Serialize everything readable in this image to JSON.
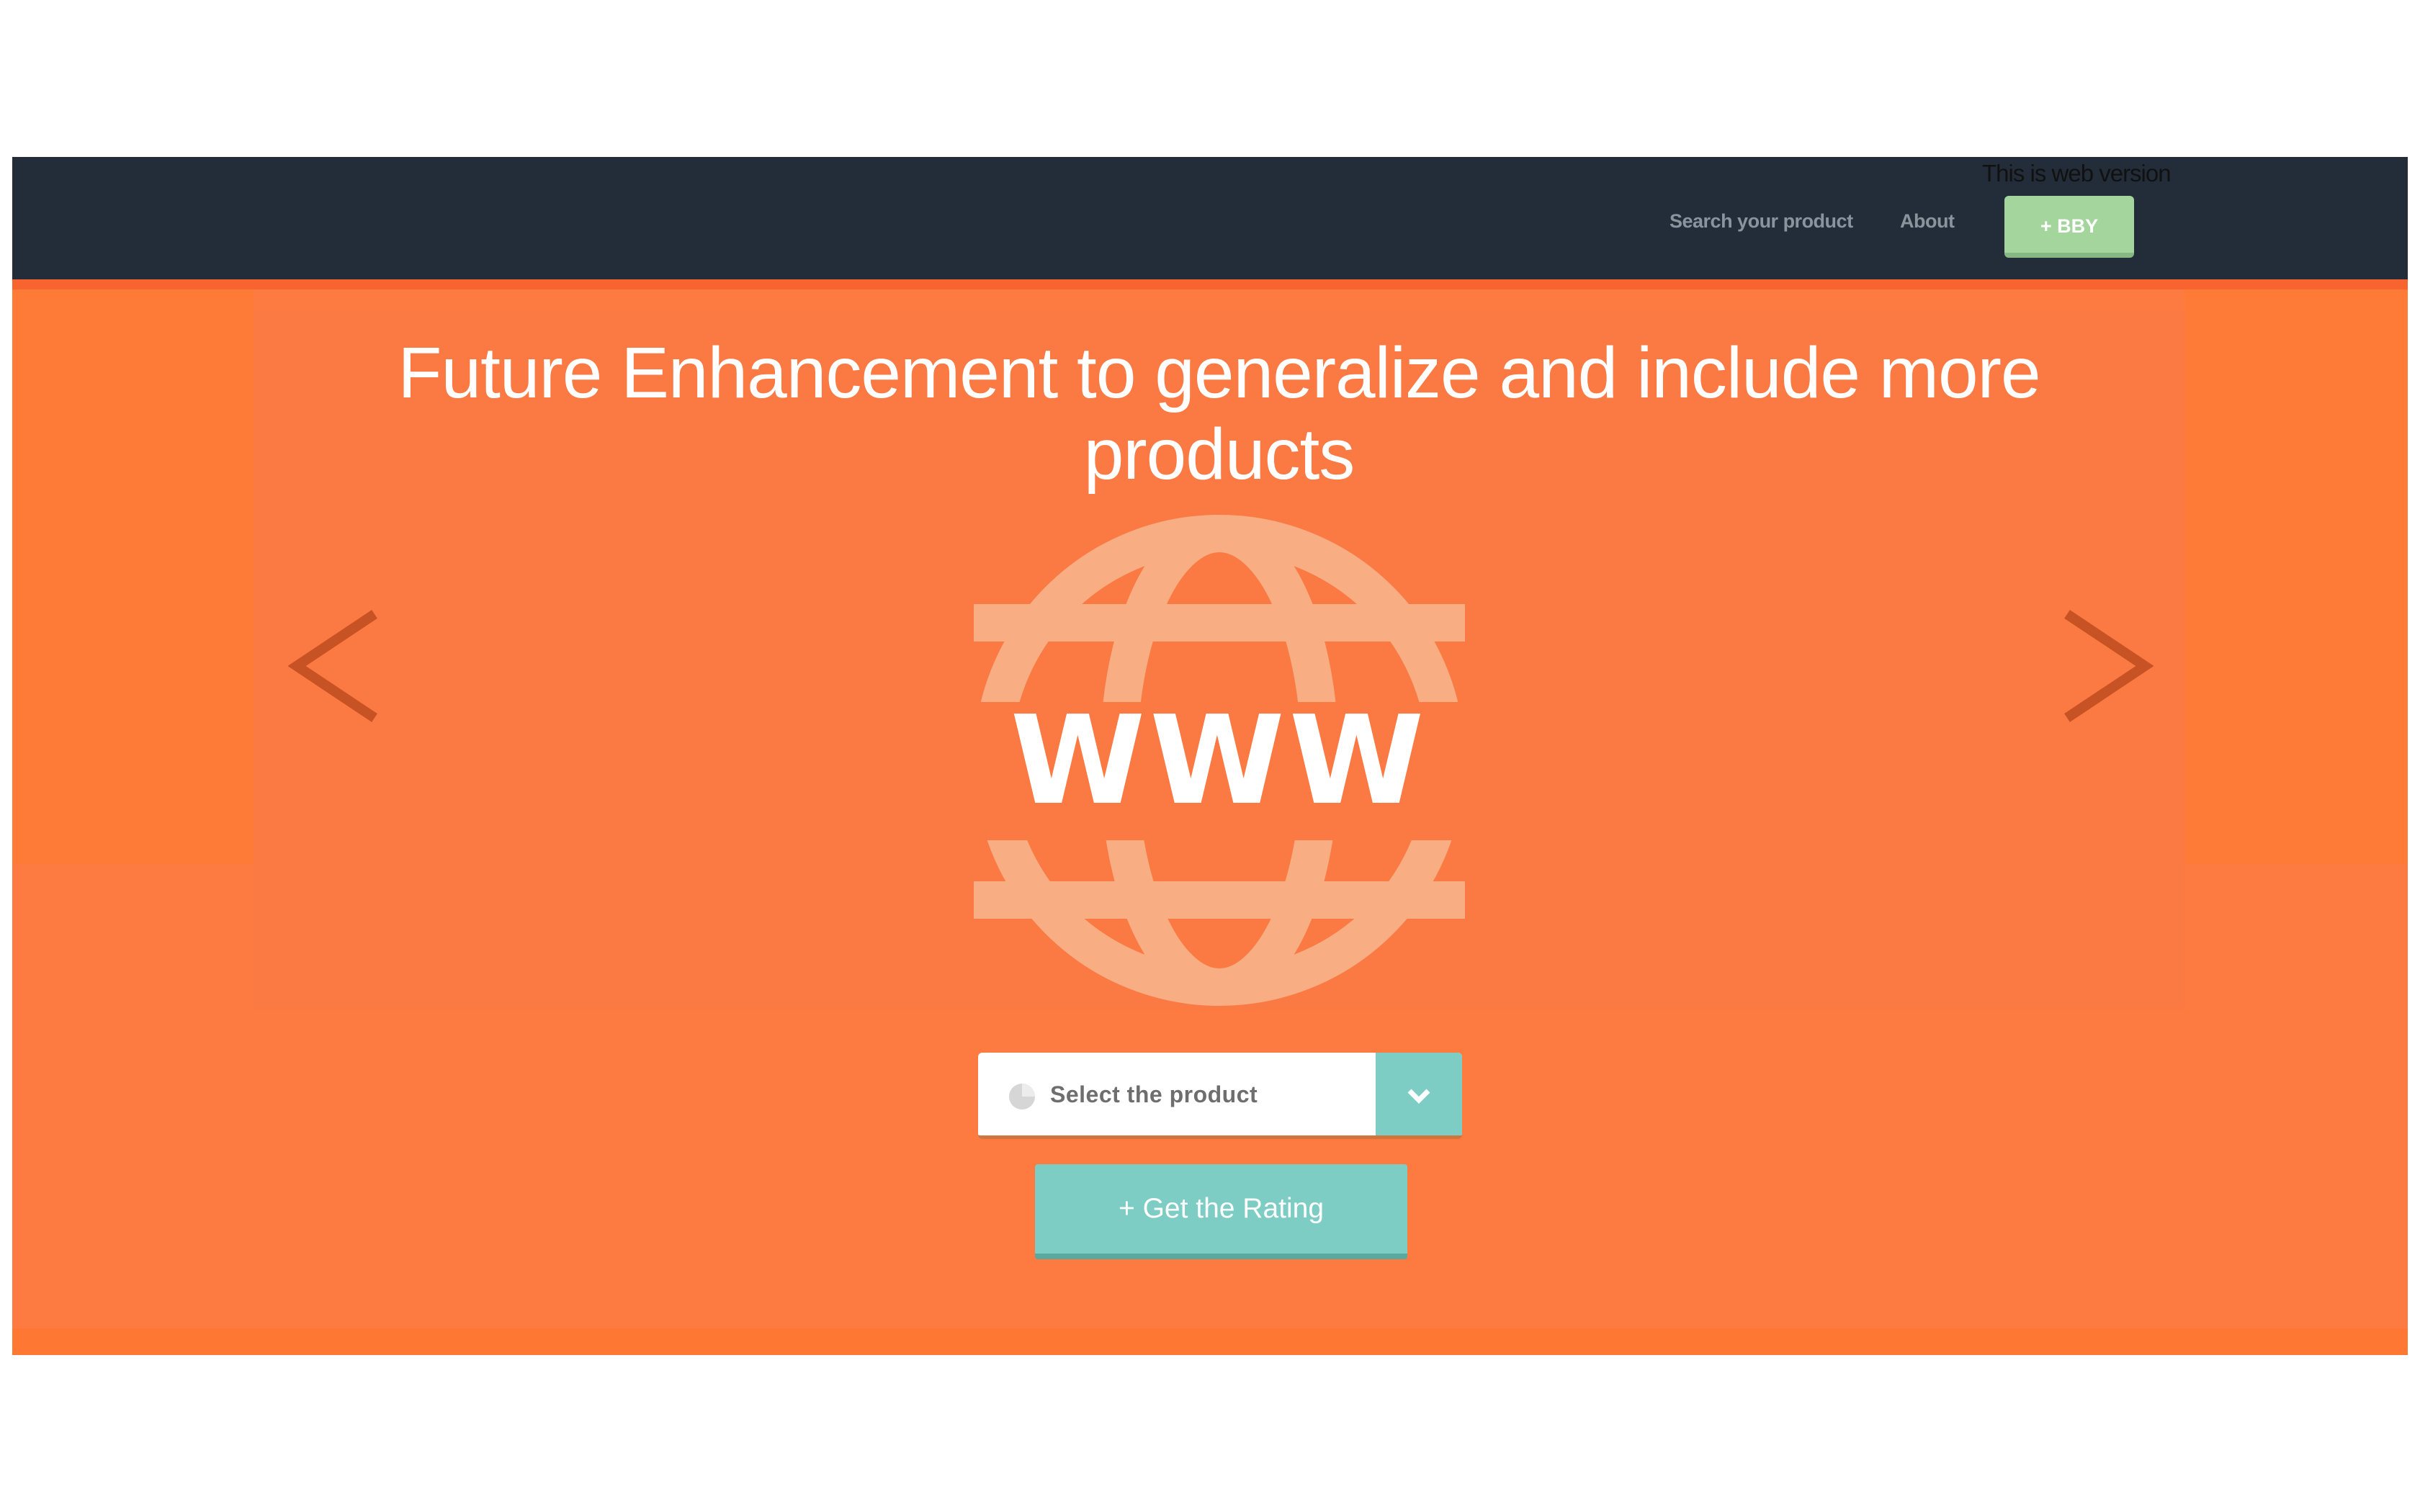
{
  "notice": {
    "text": "This is web version"
  },
  "nav": {
    "search_link": "Search your product",
    "about_link": "About",
    "cta_label": "+ BBY",
    "background": "#232d39",
    "cta_color": "#a3d59d"
  },
  "hero": {
    "headline": "Future Enhancement to generalize and include more products",
    "background": "#fd7b41",
    "prev_icon": "chevron-left-icon",
    "next_icon": "chevron-right-icon",
    "illustration_icon": "www-globe-icon",
    "illustration_text": "WWW"
  },
  "product_select": {
    "placeholder": "Select the product",
    "icon": "pie-chart-icon",
    "toggle_icon": "chevron-down-icon",
    "accent": "#7ecdc4"
  },
  "rating_button": {
    "label": "+ Get the Rating"
  }
}
